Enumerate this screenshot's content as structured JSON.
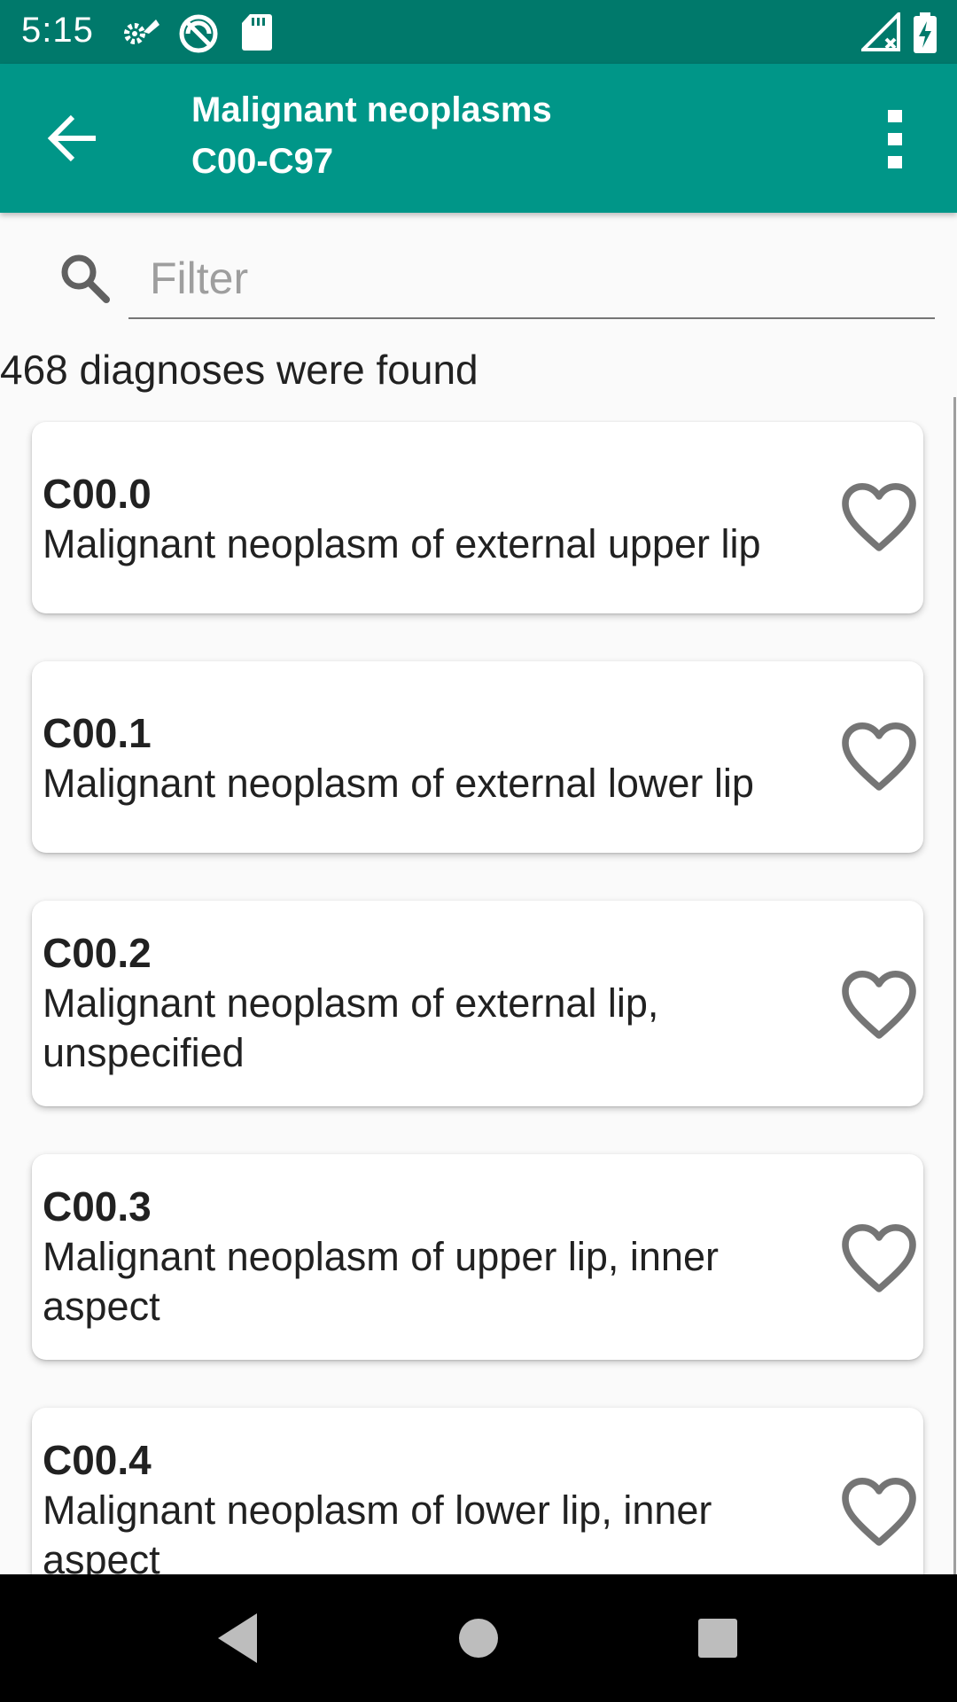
{
  "status_bar": {
    "time": "5:15",
    "icons": [
      "settings-icon",
      "vpn-icon",
      "sd-card-icon",
      "signal-icon",
      "battery-charging-icon"
    ]
  },
  "app_bar": {
    "title_line1": "Malignant neoplasms",
    "title_line2": "C00-C97",
    "back_icon": "arrow-back-icon",
    "menu_icon": "more-vert-icon"
  },
  "filter": {
    "placeholder": "Filter",
    "value": ""
  },
  "results": {
    "count_text": "468 diagnoses were found"
  },
  "diagnoses": [
    {
      "code": "C00.0",
      "description": "Malignant neoplasm of external upper lip"
    },
    {
      "code": "C00.1",
      "description": "Malignant neoplasm of external lower lip"
    },
    {
      "code": "C00.2",
      "description": "Malignant neoplasm of external lip, unspecified"
    },
    {
      "code": "C00.3",
      "description": "Malignant neoplasm of upper lip, inner aspect"
    },
    {
      "code": "C00.4",
      "description": "Malignant neoplasm of lower lip, inner aspect"
    }
  ],
  "nav_bar": {
    "icons": [
      "nav-back-icon",
      "nav-home-icon",
      "nav-recents-icon"
    ]
  },
  "colors": {
    "status_bar": "#00796b",
    "app_bar": "#009688",
    "favorite_outline": "#757575"
  }
}
